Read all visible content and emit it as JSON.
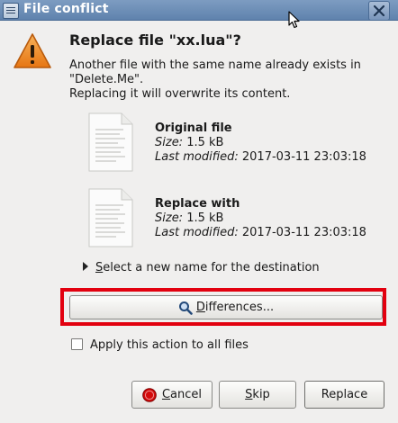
{
  "window": {
    "title": "File conflict"
  },
  "heading": "Replace file \"xx.lua\"?",
  "description": {
    "line1": "Another file with the same name already exists in",
    "line2": "\"Delete.Me\".",
    "line3": "Replacing it will overwrite its content."
  },
  "original": {
    "title": "Original file",
    "size_label": "Size:",
    "size": "1.5 kB",
    "modified_label": "Last modified:",
    "modified": "2017-03-11 23:03:18"
  },
  "replacement": {
    "title": "Replace with",
    "size_label": "Size:",
    "size": "1.5 kB",
    "modified_label": "Last modified:",
    "modified": "2017-03-11 23:03:18"
  },
  "expander": {
    "mnemonic": "S",
    "rest": "elect a new name for the destination"
  },
  "differences_button": {
    "mnemonic": "D",
    "rest": "ifferences..."
  },
  "apply_all": {
    "label": "Apply this action to all files",
    "checked": false
  },
  "buttons": {
    "cancel_mnemonic": "C",
    "cancel_rest": "ancel",
    "skip_mnemonic": "S",
    "skip_rest": "kip",
    "replace": "Replace"
  },
  "colors": {
    "highlight": "#e2000f",
    "warning": "#f08a24",
    "titlebar": "#6b8db5"
  },
  "icons": [
    "window-menu-icon",
    "close-icon",
    "warning-icon",
    "document-icon",
    "magnifier-icon",
    "stop-icon",
    "mouse-cursor-icon"
  ]
}
